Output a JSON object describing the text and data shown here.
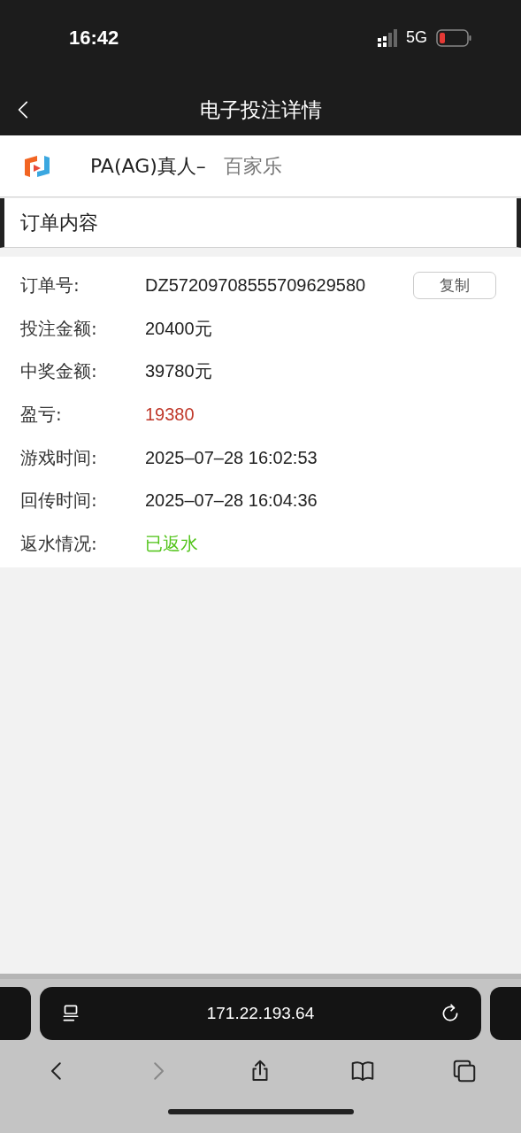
{
  "status_bar": {
    "time": "16:42",
    "network": "5G"
  },
  "nav": {
    "title": "电子投注详情"
  },
  "game": {
    "provider": "PA(AG)真人–",
    "name": "百家乐"
  },
  "section": {
    "title": "订单内容"
  },
  "details": [
    {
      "label": "订单号:",
      "value": "DZ57209708555709629580",
      "kind": "text",
      "action": "复制"
    },
    {
      "label": "投注金额:",
      "value": "20400元",
      "kind": "text"
    },
    {
      "label": "中奖金额:",
      "value": "39780元",
      "kind": "text"
    },
    {
      "label": "盈亏:",
      "value": "19380",
      "kind": "profit"
    },
    {
      "label": "游戏时间:",
      "value": "2025–07–28 16:02:53",
      "kind": "text"
    },
    {
      "label": "回传时间:",
      "value": "2025–07–28 16:04:36",
      "kind": "text"
    },
    {
      "label": "返水情况:",
      "value": "已返水",
      "kind": "status"
    }
  ],
  "browser": {
    "address": "171.22.193.64",
    "back_disabled": false,
    "forward_disabled": true
  }
}
